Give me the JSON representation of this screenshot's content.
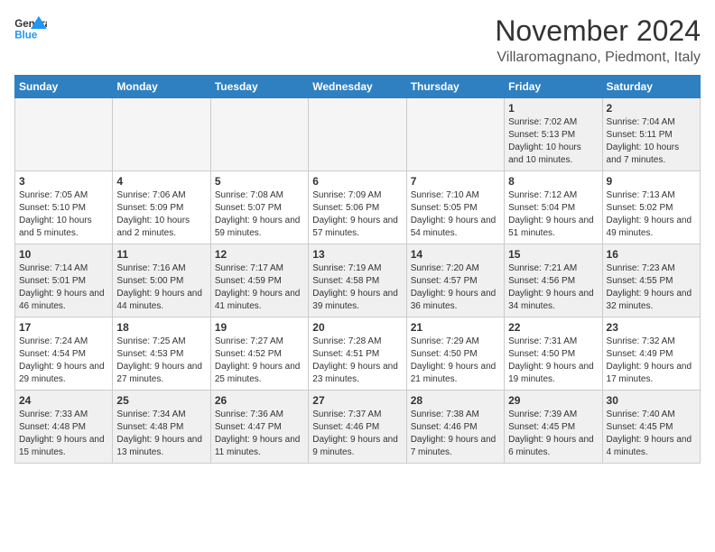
{
  "header": {
    "logo_general": "General",
    "logo_blue": "Blue",
    "month_title": "November 2024",
    "location": "Villaromagnano, Piedmont, Italy"
  },
  "days_of_week": [
    "Sunday",
    "Monday",
    "Tuesday",
    "Wednesday",
    "Thursday",
    "Friday",
    "Saturday"
  ],
  "weeks": [
    [
      {
        "day": "",
        "empty": true
      },
      {
        "day": "",
        "empty": true
      },
      {
        "day": "",
        "empty": true
      },
      {
        "day": "",
        "empty": true
      },
      {
        "day": "",
        "empty": true
      },
      {
        "day": "1",
        "sunrise": "Sunrise: 7:02 AM",
        "sunset": "Sunset: 5:13 PM",
        "daylight": "Daylight: 10 hours and 10 minutes."
      },
      {
        "day": "2",
        "sunrise": "Sunrise: 7:04 AM",
        "sunset": "Sunset: 5:11 PM",
        "daylight": "Daylight: 10 hours and 7 minutes."
      }
    ],
    [
      {
        "day": "3",
        "sunrise": "Sunrise: 7:05 AM",
        "sunset": "Sunset: 5:10 PM",
        "daylight": "Daylight: 10 hours and 5 minutes."
      },
      {
        "day": "4",
        "sunrise": "Sunrise: 7:06 AM",
        "sunset": "Sunset: 5:09 PM",
        "daylight": "Daylight: 10 hours and 2 minutes."
      },
      {
        "day": "5",
        "sunrise": "Sunrise: 7:08 AM",
        "sunset": "Sunset: 5:07 PM",
        "daylight": "Daylight: 9 hours and 59 minutes."
      },
      {
        "day": "6",
        "sunrise": "Sunrise: 7:09 AM",
        "sunset": "Sunset: 5:06 PM",
        "daylight": "Daylight: 9 hours and 57 minutes."
      },
      {
        "day": "7",
        "sunrise": "Sunrise: 7:10 AM",
        "sunset": "Sunset: 5:05 PM",
        "daylight": "Daylight: 9 hours and 54 minutes."
      },
      {
        "day": "8",
        "sunrise": "Sunrise: 7:12 AM",
        "sunset": "Sunset: 5:04 PM",
        "daylight": "Daylight: 9 hours and 51 minutes."
      },
      {
        "day": "9",
        "sunrise": "Sunrise: 7:13 AM",
        "sunset": "Sunset: 5:02 PM",
        "daylight": "Daylight: 9 hours and 49 minutes."
      }
    ],
    [
      {
        "day": "10",
        "sunrise": "Sunrise: 7:14 AM",
        "sunset": "Sunset: 5:01 PM",
        "daylight": "Daylight: 9 hours and 46 minutes."
      },
      {
        "day": "11",
        "sunrise": "Sunrise: 7:16 AM",
        "sunset": "Sunset: 5:00 PM",
        "daylight": "Daylight: 9 hours and 44 minutes."
      },
      {
        "day": "12",
        "sunrise": "Sunrise: 7:17 AM",
        "sunset": "Sunset: 4:59 PM",
        "daylight": "Daylight: 9 hours and 41 minutes."
      },
      {
        "day": "13",
        "sunrise": "Sunrise: 7:19 AM",
        "sunset": "Sunset: 4:58 PM",
        "daylight": "Daylight: 9 hours and 39 minutes."
      },
      {
        "day": "14",
        "sunrise": "Sunrise: 7:20 AM",
        "sunset": "Sunset: 4:57 PM",
        "daylight": "Daylight: 9 hours and 36 minutes."
      },
      {
        "day": "15",
        "sunrise": "Sunrise: 7:21 AM",
        "sunset": "Sunset: 4:56 PM",
        "daylight": "Daylight: 9 hours and 34 minutes."
      },
      {
        "day": "16",
        "sunrise": "Sunrise: 7:23 AM",
        "sunset": "Sunset: 4:55 PM",
        "daylight": "Daylight: 9 hours and 32 minutes."
      }
    ],
    [
      {
        "day": "17",
        "sunrise": "Sunrise: 7:24 AM",
        "sunset": "Sunset: 4:54 PM",
        "daylight": "Daylight: 9 hours and 29 minutes."
      },
      {
        "day": "18",
        "sunrise": "Sunrise: 7:25 AM",
        "sunset": "Sunset: 4:53 PM",
        "daylight": "Daylight: 9 hours and 27 minutes."
      },
      {
        "day": "19",
        "sunrise": "Sunrise: 7:27 AM",
        "sunset": "Sunset: 4:52 PM",
        "daylight": "Daylight: 9 hours and 25 minutes."
      },
      {
        "day": "20",
        "sunrise": "Sunrise: 7:28 AM",
        "sunset": "Sunset: 4:51 PM",
        "daylight": "Daylight: 9 hours and 23 minutes."
      },
      {
        "day": "21",
        "sunrise": "Sunrise: 7:29 AM",
        "sunset": "Sunset: 4:50 PM",
        "daylight": "Daylight: 9 hours and 21 minutes."
      },
      {
        "day": "22",
        "sunrise": "Sunrise: 7:31 AM",
        "sunset": "Sunset: 4:50 PM",
        "daylight": "Daylight: 9 hours and 19 minutes."
      },
      {
        "day": "23",
        "sunrise": "Sunrise: 7:32 AM",
        "sunset": "Sunset: 4:49 PM",
        "daylight": "Daylight: 9 hours and 17 minutes."
      }
    ],
    [
      {
        "day": "24",
        "sunrise": "Sunrise: 7:33 AM",
        "sunset": "Sunset: 4:48 PM",
        "daylight": "Daylight: 9 hours and 15 minutes."
      },
      {
        "day": "25",
        "sunrise": "Sunrise: 7:34 AM",
        "sunset": "Sunset: 4:48 PM",
        "daylight": "Daylight: 9 hours and 13 minutes."
      },
      {
        "day": "26",
        "sunrise": "Sunrise: 7:36 AM",
        "sunset": "Sunset: 4:47 PM",
        "daylight": "Daylight: 9 hours and 11 minutes."
      },
      {
        "day": "27",
        "sunrise": "Sunrise: 7:37 AM",
        "sunset": "Sunset: 4:46 PM",
        "daylight": "Daylight: 9 hours and 9 minutes."
      },
      {
        "day": "28",
        "sunrise": "Sunrise: 7:38 AM",
        "sunset": "Sunset: 4:46 PM",
        "daylight": "Daylight: 9 hours and 7 minutes."
      },
      {
        "day": "29",
        "sunrise": "Sunrise: 7:39 AM",
        "sunset": "Sunset: 4:45 PM",
        "daylight": "Daylight: 9 hours and 6 minutes."
      },
      {
        "day": "30",
        "sunrise": "Sunrise: 7:40 AM",
        "sunset": "Sunset: 4:45 PM",
        "daylight": "Daylight: 9 hours and 4 minutes."
      }
    ]
  ]
}
